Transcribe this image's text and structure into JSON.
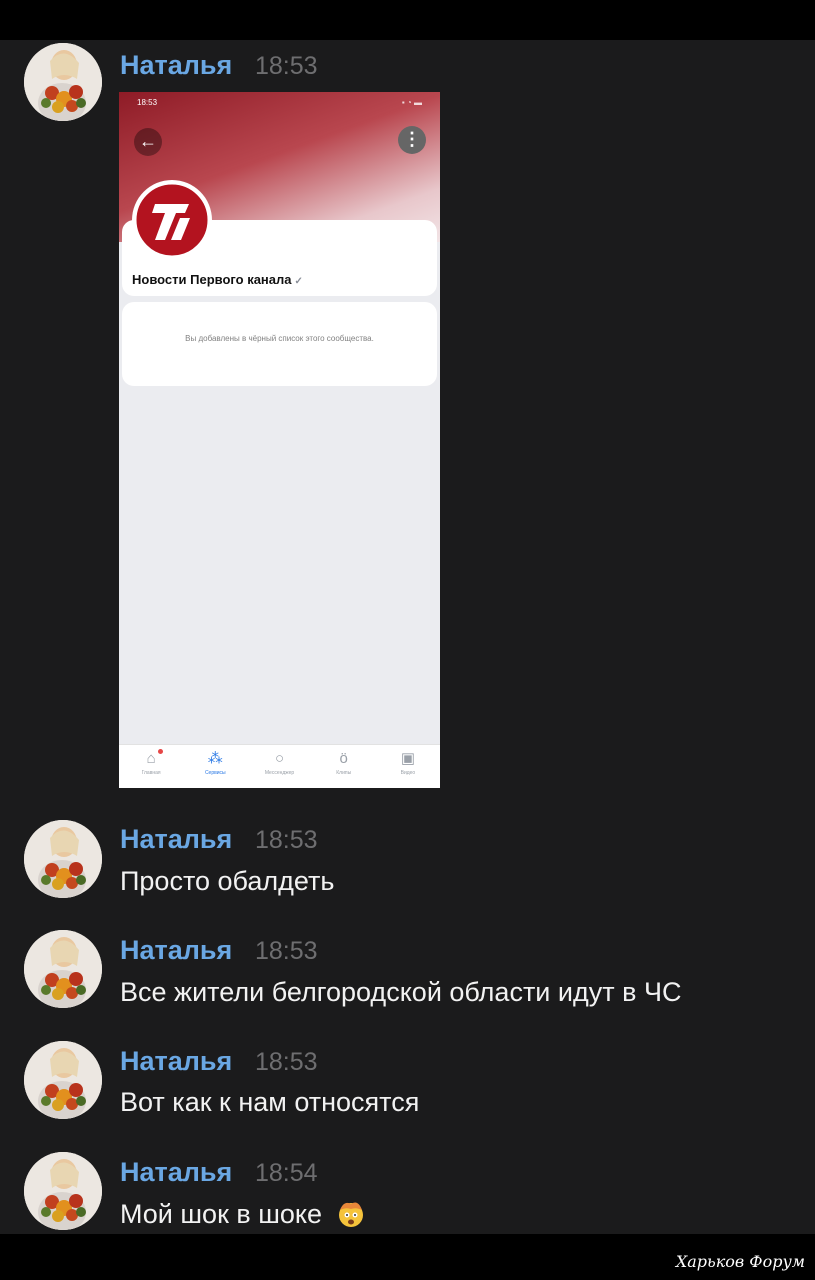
{
  "messages": [
    {
      "sender": "Наталья",
      "time": "18:53",
      "type": "image"
    },
    {
      "sender": "Наталья",
      "time": "18:53",
      "text": "Просто обалдеть"
    },
    {
      "sender": "Наталья",
      "time": "18:53",
      "text": "Все жители белгородской области идут в ЧС"
    },
    {
      "sender": "Наталья",
      "time": "18:53",
      "text": "Вот как к нам относятся"
    },
    {
      "sender": "Наталья",
      "time": "18:54",
      "text": "Мой шок в шоке"
    }
  ],
  "embedded_screenshot": {
    "status_time": "18:53",
    "channel_name": "Новости Первого канала",
    "notice": "Вы добавлены в чёрный список этого сообщества.",
    "tabs": [
      "Главная",
      "Сервисы",
      "Мессенджер",
      "Клипы",
      "Видео"
    ],
    "active_tab": "Сервисы",
    "accent_color": "#2a79e5",
    "header_color": "#8e1b26"
  },
  "watermark": "Харьков Форум",
  "colors": {
    "background": "#1b1b1c",
    "sender_name": "#6aa7e3",
    "message_text": "#f2f2f2",
    "timestamp": "#6e6e70"
  }
}
